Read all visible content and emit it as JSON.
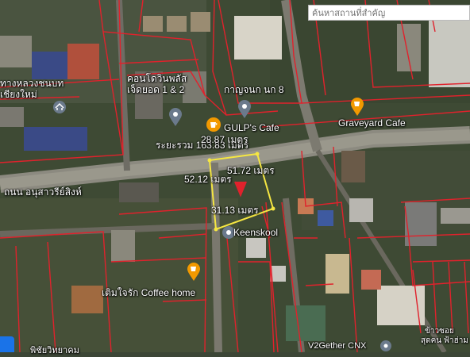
{
  "search": {
    "placeholder": "ค้นหาสถานที่สำคัญ"
  },
  "labels": {
    "school": "ทางหลวงชนบท\nเชียงใหม่",
    "condo": "คอนโดวินพลัส\nเจ็ดยอด 1 & 2",
    "kanjanok": "กาญจนก นก 8",
    "gulps": "GULP's Cafe",
    "graveyard": "Graveyard Cafe",
    "distance": "ระยะรวม 163.83 เมตร",
    "top_edge": "28.87 เมตร",
    "right_edge": "51.72 เมตร",
    "left_edge": "52.12 เมตร",
    "bottom_edge": "31.13 เมตร",
    "road": "ถนน อนุสาวรีย์สิงห์",
    "keenskool": "Keenskool",
    "coffee_home": "เติมใจรัก Coffee home",
    "bottom_right_1": "ข้าวซอย",
    "bottom_right_2": "สุดคน ฟ้าฮ่าม",
    "v2gether": "V2Gether CNX",
    "bottom_left": "พิชัยวิทยาคม"
  },
  "colors": {
    "parcel_line": "#e0222c",
    "selection": "#f5e642",
    "pin": "#e0222c",
    "poi_orange": "#f29900",
    "poi_gray": "#6b7a8c"
  },
  "icons": [
    "search-icon",
    "location-pin-icon",
    "cafe-icon",
    "poi-marker-icon",
    "school-icon"
  ]
}
